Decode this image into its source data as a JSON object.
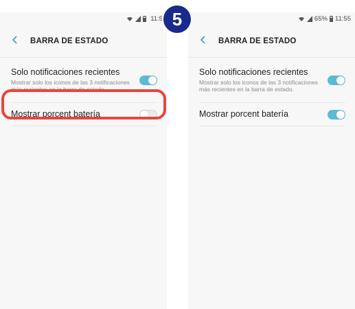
{
  "badge": {
    "step": "5"
  },
  "left": {
    "status": {
      "time": "11:5",
      "battery_percent": ""
    },
    "header": {
      "title": "BARRA DE ESTADO"
    },
    "settings": [
      {
        "title": "Solo notificaciones recientes",
        "description": "Mostrar solo los iconos de las 3 notificaciones más recientes en la barra de estado.",
        "toggle": "on"
      },
      {
        "title": "Mostrar porcent batería",
        "toggle": "off"
      }
    ]
  },
  "right": {
    "status": {
      "time": "11:55",
      "battery_percent": "65%"
    },
    "header": {
      "title": "BARRA DE ESTADO"
    },
    "settings": [
      {
        "title": "Solo notificaciones recientes",
        "description": "Mostrar solo los iconos de las 3 notificaciones más recientes en la barra de estado.",
        "toggle": "on"
      },
      {
        "title": "Mostrar porcent batería",
        "toggle": "on"
      }
    ]
  },
  "colors": {
    "accent": "#5bbbd6",
    "highlight": "#e8453c",
    "badge": "#1a2a8a"
  },
  "icons": {
    "back": "chevron-left-icon",
    "wifi": "wifi-icon",
    "signal": "signal-icon",
    "battery": "battery-icon"
  }
}
